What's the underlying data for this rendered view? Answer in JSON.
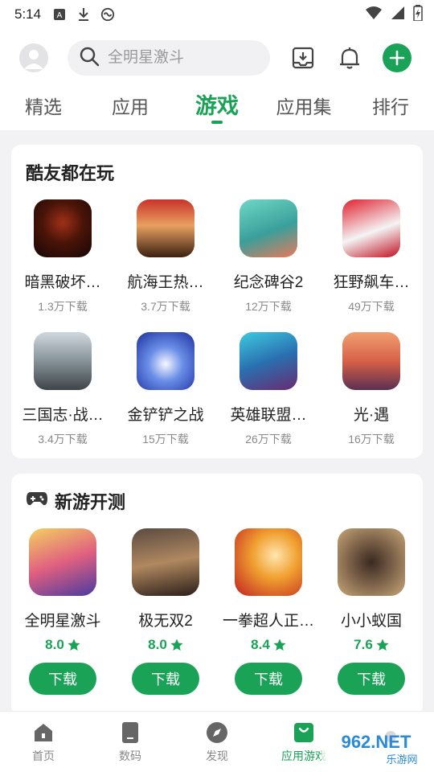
{
  "status": {
    "time": "5:14"
  },
  "header": {
    "search_placeholder": "全明星激斗",
    "icons": [
      "avatar-icon",
      "search-icon",
      "download-manager-icon",
      "bell-icon",
      "plus-icon"
    ]
  },
  "tabs": [
    {
      "label": "精选"
    },
    {
      "label": "应用"
    },
    {
      "label": "游戏"
    },
    {
      "label": "应用集"
    },
    {
      "label": "排行"
    }
  ],
  "active_tab": "游戏",
  "section1": {
    "title": "酷友都在玩",
    "apps": [
      {
        "name": "暗黑破坏…",
        "downloads": "1.3万下载"
      },
      {
        "name": "航海王热…",
        "downloads": "3.7万下载"
      },
      {
        "name": "纪念碑谷2",
        "downloads": "12万下载"
      },
      {
        "name": "狂野飙车…",
        "downloads": "49万下载"
      },
      {
        "name": "三国志·战…",
        "downloads": "3.4万下载"
      },
      {
        "name": "金铲铲之战",
        "downloads": "15万下载"
      },
      {
        "name": "英雄联盟…",
        "downloads": "26万下载"
      },
      {
        "name": "光·遇",
        "downloads": "16万下载"
      }
    ]
  },
  "section2": {
    "title": "新游开测",
    "apps": [
      {
        "name": "全明星激斗",
        "rating": "8.0"
      },
      {
        "name": "极无双2",
        "rating": "8.0"
      },
      {
        "name": "一拳超人正…",
        "rating": "8.4"
      },
      {
        "name": "小小蚁国",
        "rating": "7.6"
      }
    ],
    "button_label": "下载"
  },
  "bottom_nav": [
    {
      "label": "首页"
    },
    {
      "label": "数码"
    },
    {
      "label": "发现"
    },
    {
      "label": "应用游戏"
    }
  ],
  "colors": {
    "accent": "#1aa356",
    "background": "#f2f2f4"
  },
  "watermark": {
    "text": "962.NET",
    "subtext": "乐游网"
  }
}
